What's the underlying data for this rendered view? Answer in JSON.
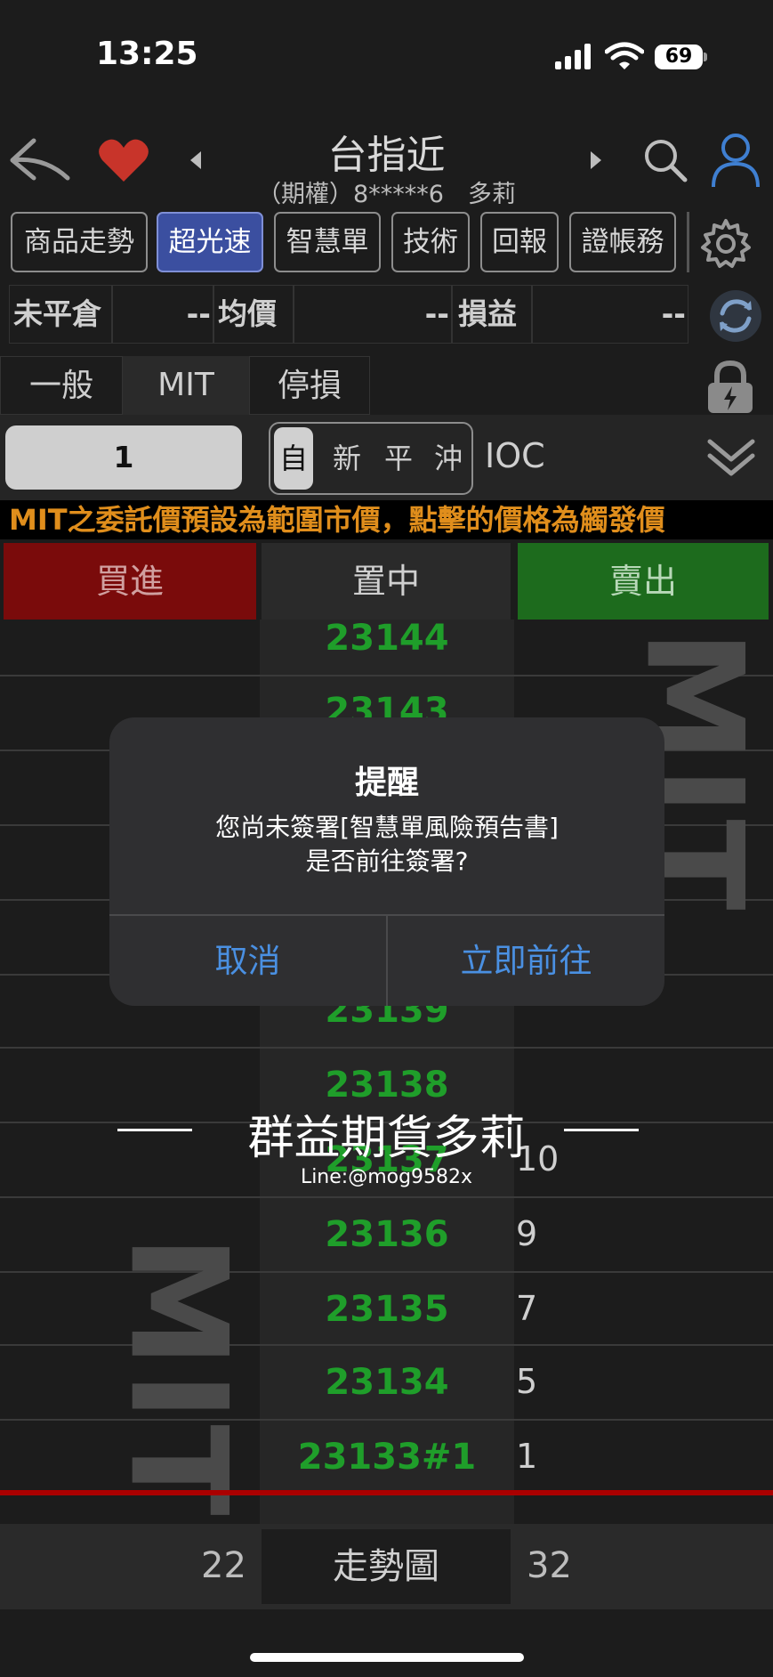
{
  "status_bar": {
    "time": "13:25",
    "battery": "69"
  },
  "header": {
    "product_title": "台指近",
    "account": "（期權）8*****6　多莉",
    "icons": [
      "back-arrow-icon",
      "heart-icon",
      "caret-left-icon",
      "caret-right-icon",
      "search-icon",
      "user-icon"
    ]
  },
  "nav_tabs": [
    {
      "label": "商品走勢",
      "active": false
    },
    {
      "label": "超光速",
      "active": true
    },
    {
      "label": "智慧單",
      "active": false
    },
    {
      "label": "技術",
      "active": false
    },
    {
      "label": "回報",
      "active": false
    },
    {
      "label": "證帳務",
      "active": false
    }
  ],
  "position_row": {
    "open_label": "未平倉",
    "open_value": "--",
    "avg_label": "均價",
    "avg_value": "--",
    "pnl_label": "損益",
    "pnl_value": "--"
  },
  "order_tabs": [
    {
      "label": "一般",
      "active": false
    },
    {
      "label": "MIT",
      "active": true
    },
    {
      "label": "停損",
      "active": false
    }
  ],
  "order_form": {
    "quantity": "1",
    "position_types": [
      {
        "label": "自",
        "active": true
      },
      {
        "label": "新",
        "active": false
      },
      {
        "label": "平",
        "active": false
      },
      {
        "label": "沖",
        "active": false
      }
    ],
    "time_in_force": "IOC"
  },
  "notice": "MIT之委託價預設為範圍市價，點擊的價格為觸發價",
  "action_buttons": {
    "buy": "買進",
    "center": "置中",
    "sell": "賣出"
  },
  "ladder": {
    "watermark": "MIT",
    "rows": [
      {
        "price": "23144",
        "vol": ""
      },
      {
        "price": "23143",
        "vol": ""
      },
      {
        "price": "23139",
        "vol": ""
      },
      {
        "price": "23138",
        "vol": ""
      },
      {
        "price": "23137",
        "vol": "10"
      },
      {
        "price": "23136",
        "vol": "9"
      },
      {
        "price": "23135",
        "vol": "7"
      },
      {
        "price": "23134",
        "vol": "5"
      },
      {
        "price": "23133#1",
        "vol": "1"
      }
    ],
    "buy_total": "22",
    "sell_total": "32"
  },
  "bottom": {
    "trend_button": "走勢圖"
  },
  "brand_watermark": {
    "name": "群益期貨多莉",
    "line_id": "Line:@mog9582x"
  },
  "dialog": {
    "title": "提醒",
    "message_line1": "您尚未簽署[智慧單風險預告書]",
    "message_line2": "是否前往簽署?",
    "cancel": "取消",
    "confirm": "立即前往"
  },
  "colors": {
    "buy": "#7a0b0b",
    "sell": "#1d6b1d",
    "active_tab": "#3b4fa0",
    "price_green": "#1f9e2a",
    "notice_orange": "#e08e1c",
    "dialog_link": "#4a90e2"
  }
}
